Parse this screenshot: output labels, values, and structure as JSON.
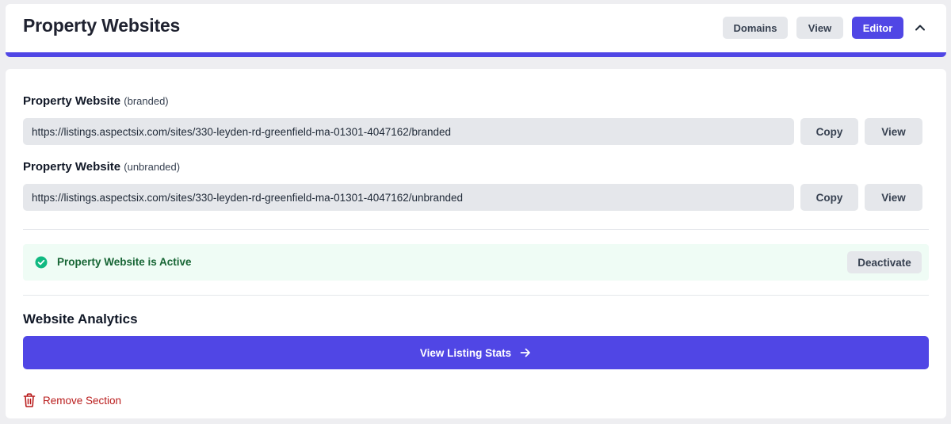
{
  "header": {
    "title": "Property Websites",
    "domains_label": "Domains",
    "view_label": "View",
    "editor_label": "Editor",
    "collapse_icon": "chevron-up-icon"
  },
  "branded": {
    "label": "Property Website",
    "sub": "(branded)",
    "url": "https://listings.aspectsix.com/sites/330-leyden-rd-greenfield-ma-01301-4047162/branded",
    "copy_label": "Copy",
    "view_label": "View"
  },
  "unbranded": {
    "label": "Property Website",
    "sub": "(unbranded)",
    "url": "https://listings.aspectsix.com/sites/330-leyden-rd-greenfield-ma-01301-4047162/unbranded",
    "copy_label": "Copy",
    "view_label": "View"
  },
  "status": {
    "text": "Property Website is Active",
    "icon": "check-circle-icon",
    "deactivate_label": "Deactivate"
  },
  "analytics": {
    "title": "Website Analytics",
    "button_label": "View Listing Stats",
    "button_icon": "arrow-right-icon"
  },
  "remove": {
    "label": "Remove Section",
    "icon": "trash-icon"
  },
  "colors": {
    "accent": "#5046e5",
    "success_bg": "#effcf5",
    "success_icon": "#10b981",
    "danger": "#b91c1c"
  }
}
